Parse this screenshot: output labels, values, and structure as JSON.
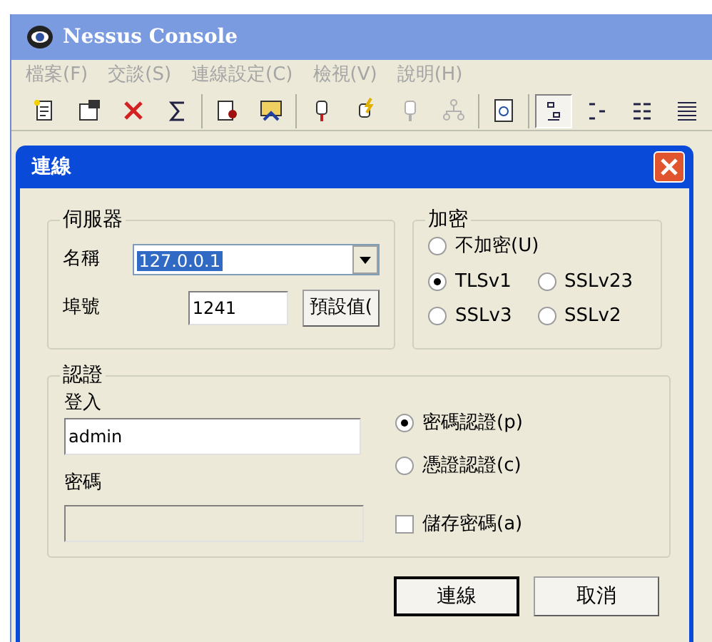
{
  "window": {
    "title": "Nessus Console"
  },
  "menu": [
    {
      "label": "檔案(F)",
      "disabled": true
    },
    {
      "label": "交談(S)",
      "disabled": true
    },
    {
      "label": "連線設定(C)",
      "disabled": true
    },
    {
      "label": "檢視(V)",
      "disabled": true
    },
    {
      "label": "說明(H)",
      "disabled": true
    }
  ],
  "toolbar": [
    [
      {
        "kind": "new",
        "disabled": false,
        "selected": false
      },
      {
        "kind": "props",
        "disabled": false,
        "selected": false
      },
      {
        "kind": "delete",
        "disabled": false,
        "selected": false
      },
      {
        "kind": "sum",
        "disabled": false,
        "selected": false
      }
    ],
    [
      {
        "kind": "person",
        "disabled": false,
        "selected": false
      },
      {
        "kind": "people",
        "disabled": false,
        "selected": false
      }
    ],
    [
      {
        "kind": "plug",
        "disabled": false,
        "selected": false
      },
      {
        "kind": "bolt",
        "disabled": false,
        "selected": false
      },
      {
        "kind": "plug",
        "disabled": true,
        "selected": false
      },
      {
        "kind": "tree",
        "disabled": true,
        "selected": false
      }
    ],
    [
      {
        "kind": "refresh",
        "disabled": false,
        "selected": false
      }
    ],
    [
      {
        "kind": "view1",
        "disabled": false,
        "selected": true
      },
      {
        "kind": "view2",
        "disabled": false,
        "selected": false
      },
      {
        "kind": "view3",
        "disabled": false,
        "selected": false
      },
      {
        "kind": "view4",
        "disabled": false,
        "selected": false
      }
    ]
  ],
  "dialog": {
    "title": "連線",
    "server": {
      "title": "伺服器",
      "name_label": "名稱",
      "name_value": "127.0.0.1",
      "port_label": "埠號",
      "port_value": "1241",
      "default_button": "預設值("
    },
    "encryption": {
      "title": "加密",
      "options": [
        {
          "label": "不加密(U)",
          "selected": false
        },
        {
          "label": "TLSv1",
          "selected": true
        },
        {
          "label": "SSLv23",
          "selected": false
        },
        {
          "label": "SSLv3",
          "selected": false
        },
        {
          "label": "SSLv2",
          "selected": false
        }
      ]
    },
    "auth": {
      "title": "認證",
      "login_label": "登入",
      "login_value": "admin",
      "password_label": "密碼",
      "password_disabled": true,
      "methods": [
        {
          "label": "密碼認證(p)",
          "selected": true
        },
        {
          "label": "憑證認證(c)",
          "selected": false
        }
      ],
      "save_password": {
        "label": "儲存密碼(a)",
        "checked": false
      }
    },
    "buttons": [
      {
        "label": "連線",
        "default": true
      },
      {
        "label": "取消",
        "default": false
      }
    ]
  }
}
